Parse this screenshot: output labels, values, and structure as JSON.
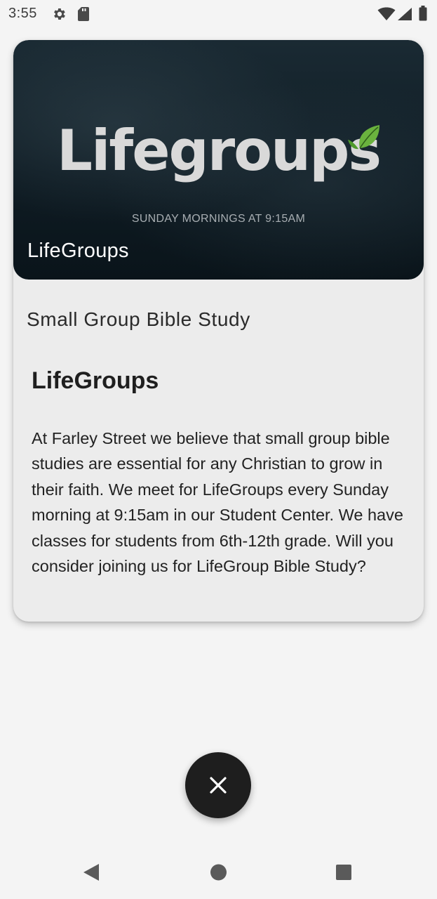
{
  "status_bar": {
    "time": "3:55",
    "icons": [
      "gear-icon",
      "sd-card-icon",
      "wifi-icon",
      "signal-icon",
      "battery-icon"
    ]
  },
  "card": {
    "hero": {
      "logo_text": "Lifegroups",
      "tagline": "SUNDAY MORNINGS AT 9:15AM",
      "caption": "LifeGroups"
    },
    "subtitle": "Small Group Bible Study",
    "heading": "LifeGroups",
    "body": "At Farley Street we believe that small group bible studies are essential for any Christian to grow in their faith. We meet for LifeGroups every Sunday morning at 9:15am in our Student Center. We have classes for students from 6th-12th grade. Will you consider joining us for LifeGroup Bible Study?"
  },
  "fab": {
    "icon": "close-icon"
  },
  "nav_bar": {
    "icons": [
      "back-icon",
      "home-icon",
      "recents-icon"
    ]
  },
  "colors": {
    "background": "#f4f4f4",
    "card": "#ececec",
    "hero_dark": "#0f1c24",
    "leaf_green": "#6ab23e",
    "fab": "#1e1e1e"
  }
}
